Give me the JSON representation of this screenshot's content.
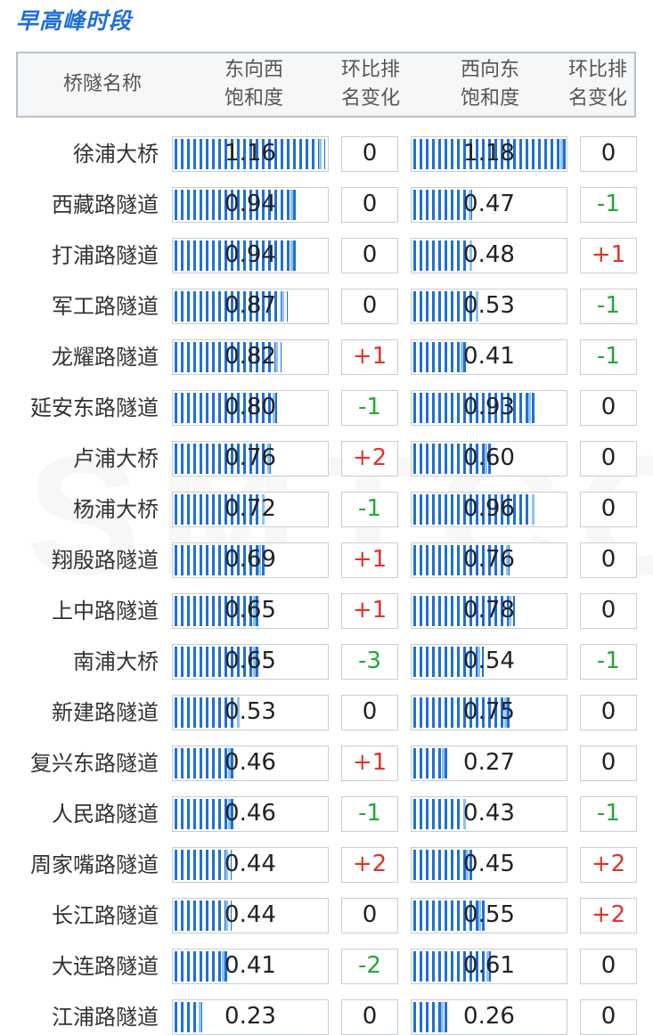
{
  "title": "早高峰时段",
  "header": {
    "col_name": "桥隧名称",
    "col_ew": "东向西\n饱和度",
    "col_ew_change": "环比排\n名变化",
    "col_we": "西向东\n饱和度",
    "col_we_change": "环比排\n名变化"
  },
  "rows": [
    {
      "name": "徐浦大桥",
      "ew": "1.16",
      "ew_change": "0",
      "we": "1.18",
      "we_change": "0"
    },
    {
      "name": "西藏路隧道",
      "ew": "0.94",
      "ew_change": "0",
      "we": "0.47",
      "we_change": "-1"
    },
    {
      "name": "打浦路隧道",
      "ew": "0.94",
      "ew_change": "0",
      "we": "0.48",
      "we_change": "+1"
    },
    {
      "name": "军工路隧道",
      "ew": "0.87",
      "ew_change": "0",
      "we": "0.53",
      "we_change": "-1"
    },
    {
      "name": "龙耀路隧道",
      "ew": "0.82",
      "ew_change": "+1",
      "we": "0.41",
      "we_change": "-1"
    },
    {
      "name": "延安东路隧道",
      "ew": "0.80",
      "ew_change": "-1",
      "we": "0.93",
      "we_change": "0"
    },
    {
      "name": "卢浦大桥",
      "ew": "0.76",
      "ew_change": "+2",
      "we": "0.60",
      "we_change": "0"
    },
    {
      "name": "杨浦大桥",
      "ew": "0.72",
      "ew_change": "-1",
      "we": "0.96",
      "we_change": "0"
    },
    {
      "name": "翔殷路隧道",
      "ew": "0.69",
      "ew_change": "+1",
      "we": "0.76",
      "we_change": "0"
    },
    {
      "name": "上中路隧道",
      "ew": "0.65",
      "ew_change": "+1",
      "we": "0.78",
      "we_change": "0"
    },
    {
      "name": "南浦大桥",
      "ew": "0.65",
      "ew_change": "-3",
      "we": "0.54",
      "we_change": "-1"
    },
    {
      "name": "新建路隧道",
      "ew": "0.53",
      "ew_change": "0",
      "we": "0.75",
      "we_change": "0"
    },
    {
      "name": "复兴东路隧道",
      "ew": "0.46",
      "ew_change": "+1",
      "we": "0.27",
      "we_change": "0"
    },
    {
      "name": "人民路隧道",
      "ew": "0.46",
      "ew_change": "-1",
      "we": "0.43",
      "we_change": "-1"
    },
    {
      "name": "周家嘴路隧道",
      "ew": "0.44",
      "ew_change": "+2",
      "we": "0.45",
      "we_change": "+2"
    },
    {
      "name": "长江路隧道",
      "ew": "0.44",
      "ew_change": "0",
      "we": "0.55",
      "we_change": "+2"
    },
    {
      "name": "大连路隧道",
      "ew": "0.41",
      "ew_change": "-2",
      "we": "0.61",
      "we_change": "0"
    },
    {
      "name": "江浦路隧道",
      "ew": "0.23",
      "ew_change": "0",
      "we": "0.26",
      "we_change": "0"
    }
  ],
  "bar_max_value": 1.18,
  "colors": {
    "title": "#1f6fd6",
    "bar_fill": "#1f6fd6",
    "bar_tip": "#8cc3f2",
    "rank_up": "#e0342a",
    "rank_down": "#22a83a",
    "neutral": "#222222"
  }
}
